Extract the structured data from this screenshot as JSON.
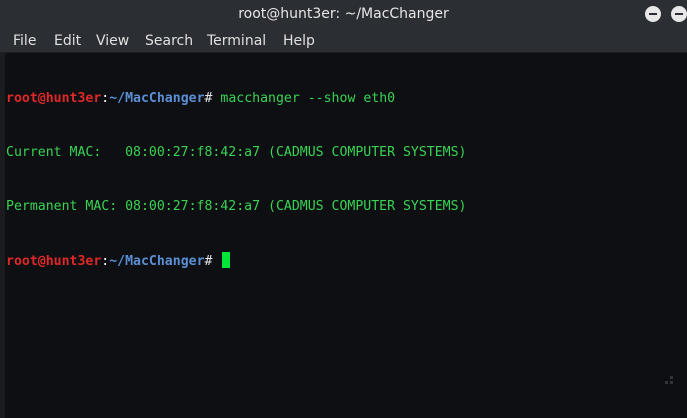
{
  "window": {
    "title": "root@hunt3er: ~/MacChanger"
  },
  "menu": {
    "items": [
      "File",
      "Edit",
      "View",
      "Search",
      "Terminal",
      "Help"
    ]
  },
  "terminal": {
    "prompt": {
      "user_host": "root@hunt3er",
      "colon": ":",
      "path": "~/MacChanger",
      "symbol": "# "
    },
    "command": "macchanger --show eth0",
    "output": [
      "Current MAC:   08:00:27:f8:42:a7 (CADMUS COMPUTER SYSTEMS)",
      "Permanent MAC: 08:00:27:f8:42:a7 (CADMUS COMPUTER SYSTEMS)"
    ]
  },
  "colors": {
    "background": "#0d0f13",
    "titlebar": "#2b2e33",
    "prompt_user": "#e02828",
    "prompt_path": "#5b8fd4",
    "text_green": "#39d353",
    "cursor": "#00e63a"
  }
}
